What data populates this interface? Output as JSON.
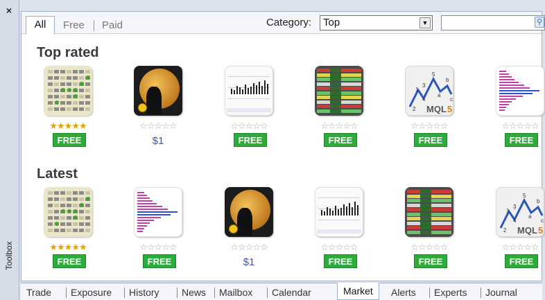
{
  "window": {
    "close_glyph": "×",
    "toolbox_label": "Toolbox"
  },
  "filter": {
    "tabs": [
      "All",
      "Free",
      "Paid"
    ],
    "active_tab": "All",
    "category_label": "Category:",
    "category_value": "Top",
    "search_value": "",
    "search_icon": "search-icon"
  },
  "sections": {
    "top_rated": {
      "title": "Top rated",
      "items": [
        {
          "thumb": "board",
          "stars": 5,
          "price": "FREE"
        },
        {
          "thumb": "moon",
          "stars": 0,
          "price": "$1"
        },
        {
          "thumb": "chart",
          "stars": 0,
          "price": "FREE"
        },
        {
          "thumb": "table",
          "stars": 0,
          "price": "FREE"
        },
        {
          "thumb": "mql",
          "stars": 0,
          "price": "FREE"
        },
        {
          "thumb": "hist",
          "stars": 0,
          "price": "FREE"
        }
      ]
    },
    "latest": {
      "title": "Latest",
      "items": [
        {
          "thumb": "board",
          "stars": 5,
          "price": "FREE"
        },
        {
          "thumb": "hist",
          "stars": 0,
          "price": "FREE"
        },
        {
          "thumb": "moon",
          "stars": 0,
          "price": "$1"
        },
        {
          "thumb": "chart",
          "stars": 0,
          "price": "FREE"
        },
        {
          "thumb": "table",
          "stars": 0,
          "price": "FREE"
        },
        {
          "thumb": "mql",
          "stars": 0,
          "price": "FREE"
        }
      ]
    }
  },
  "mql_logo": {
    "text": "MQL",
    "digit": "5",
    "wave_numbers": [
      "1",
      "2",
      "3",
      "4",
      "5",
      "a",
      "b",
      "c"
    ]
  },
  "bottom_tabs": [
    "Trade",
    "Exposure",
    "History",
    "News",
    "Mailbox",
    "Calendar",
    "Market",
    "Alerts",
    "Experts",
    "Journal"
  ],
  "active_bottom_tab": "Market",
  "colors": {
    "free_badge": "#2dac3c",
    "price_link": "#4056a0",
    "star_gold": "#e4a400",
    "panel_border": "#9fb0c8"
  }
}
